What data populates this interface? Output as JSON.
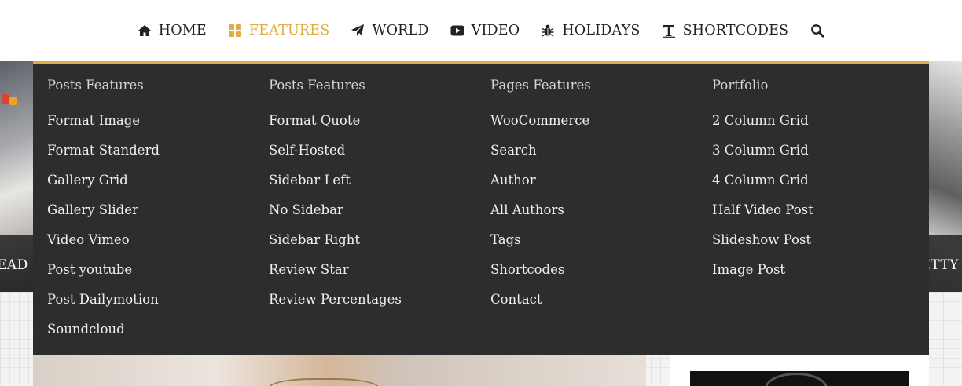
{
  "nav": {
    "items": [
      {
        "label": "HOME",
        "icon": "home-icon"
      },
      {
        "label": "FEATURES",
        "icon": "grid-icon",
        "active": true
      },
      {
        "label": "WORLD",
        "icon": "paper-plane-icon"
      },
      {
        "label": "VIDEO",
        "icon": "youtube-play-icon"
      },
      {
        "label": "HOLIDAYS",
        "icon": "bug-icon"
      },
      {
        "label": "SHORTCODES",
        "icon": "text-t-icon"
      }
    ],
    "search_icon": "search-icon",
    "accent_color": "#e0ad45",
    "text_color": "#222222"
  },
  "slider": {
    "left_caption": "EAD O",
    "right_caption": "ETTY"
  },
  "megamenu": {
    "background": "#2d2d2d",
    "columns": [
      {
        "title": "Posts Features",
        "links": [
          "Format Image",
          "Format Standerd",
          "Gallery Grid",
          "Gallery Slider",
          "Video Vimeo",
          "Post youtube",
          "Post Dailymotion",
          "Soundcloud"
        ]
      },
      {
        "title": "Posts Features",
        "links": [
          "Format Quote",
          "Self-Hosted",
          "Sidebar Left",
          "No Sidebar",
          "Sidebar Right",
          "Review Star",
          "Review Percentages"
        ]
      },
      {
        "title": "Pages Features",
        "links": [
          "WooCommerce",
          "Search",
          "Author",
          "All Authors",
          "Tags",
          "Shortcodes",
          "Contact"
        ]
      },
      {
        "title": "Portfolio",
        "links": [
          "2 Column Grid",
          "3 Column Grid",
          "4 Column Grid",
          "Half Video Post",
          "Slideshow Post",
          "Image Post"
        ]
      }
    ]
  }
}
